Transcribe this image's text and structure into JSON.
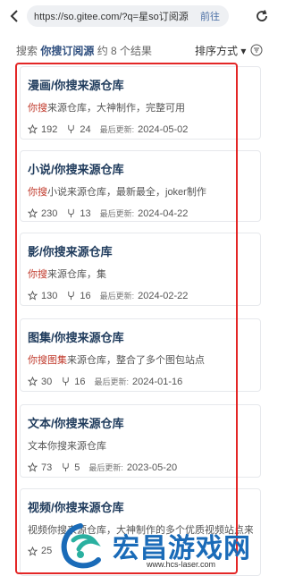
{
  "browser": {
    "url": "https://so.gitee.com/?q=星so订阅源",
    "go_label": "前往"
  },
  "search": {
    "prefix": "搜索",
    "keyword": "你搜订阅源",
    "count_text": "约 8 个结果",
    "sort_label": "排序方式 ▾"
  },
  "results": [
    {
      "title": "漫画/你搜来源仓库",
      "desc_hl": "你搜",
      "desc_rest": "来源仓库，大神制作，完整可用",
      "stars": "192",
      "forks": "24",
      "updated_label": "最后更新:",
      "updated": "2024-05-02"
    },
    {
      "title": "小说/你搜来源仓库",
      "desc_hl": "你搜",
      "desc_rest": "小说来源仓库，最新最全，joker制作",
      "stars": "230",
      "forks": "13",
      "updated_label": "最后更新:",
      "updated": "2024-04-22"
    },
    {
      "title": "影/你搜来源仓库",
      "desc_hl": "你搜",
      "desc_rest": "来源仓库，集",
      "stars": "130",
      "forks": "16",
      "updated_label": "最后更新:",
      "updated": "2024-02-22"
    },
    {
      "title": "图集/你搜来源仓库",
      "desc_hl": "你搜图集",
      "desc_rest": "来源仓库，整合了多个图包站点",
      "stars": "30",
      "forks": "16",
      "updated_label": "最后更新:",
      "updated": "2024-01-16"
    },
    {
      "title": "文本/你搜来源仓库",
      "desc_hl": "",
      "desc_rest": "文本你搜来源仓库",
      "stars": "73",
      "forks": "5",
      "updated_label": "最后更新:",
      "updated": "2023-05-20"
    },
    {
      "title": "视频/你搜来源仓库",
      "desc_hl": "",
      "desc_rest": "视频你搜来源仓库，大神制作的多个优质视频站点来源",
      "stars": "25",
      "forks": "",
      "updated_label": "",
      "updated": ""
    }
  ],
  "watermark": {
    "name": "宏昌游戏网",
    "url": "www.hcs-laser.com"
  },
  "colors": {
    "highlight_box": "#e32626",
    "title": "#1f3b5c",
    "watermark": "#1a6bb8"
  }
}
